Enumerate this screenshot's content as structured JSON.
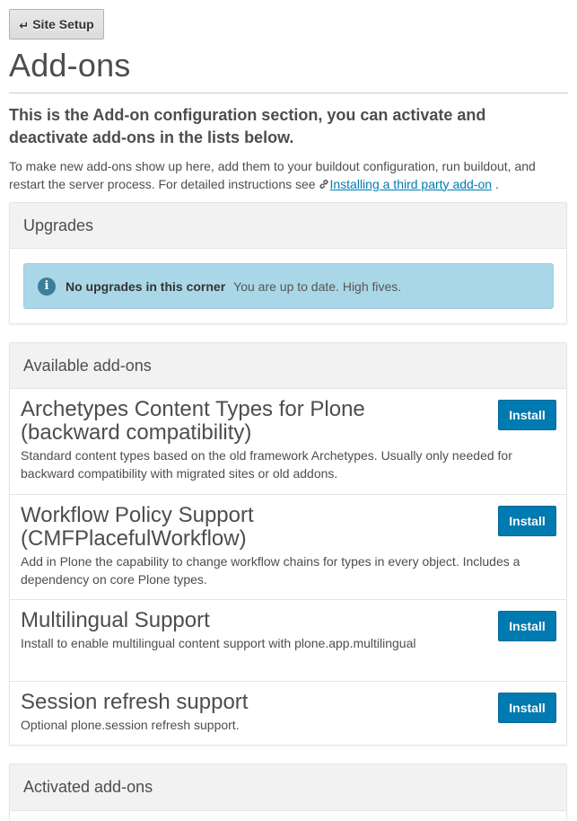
{
  "toolbar": {
    "back_label": "Site Setup"
  },
  "page": {
    "title": "Add-ons",
    "lead": "This is the Add-on configuration section, you can activate and deactivate add-ons in the lists below.",
    "instructions_text": "To make new add-ons show up here, add them to your buildout configuration, run buildout, and restart the server process. For detailed instructions see",
    "instructions_link": "Installing a third party add-on",
    "instructions_end": "."
  },
  "upgrades": {
    "heading": "Upgrades",
    "info_title": "No upgrades in this corner",
    "info_text": "You are up to date. High fives."
  },
  "available": {
    "heading": "Available add-ons",
    "install_label": "Install",
    "addons": [
      {
        "title": "Archetypes Content Types for Plone (backward compatibility)",
        "description": "Standard content types based on the old framework Archetypes. Usually only needed for backward compatibility with migrated sites or old addons."
      },
      {
        "title": "Workflow Policy Support (CMFPlacefulWorkflow)",
        "description": "Add in Plone the capability to change workflow chains for types in every object. Includes a dependency on core Plone types."
      },
      {
        "title": "Multilingual Support",
        "description": "Install to enable multilingual content support with plone.app.multilingual"
      },
      {
        "title": "Session refresh support",
        "description": "Optional plone.session refresh support."
      }
    ]
  },
  "activated": {
    "heading": "Activated add-ons"
  },
  "colors": {
    "primary": "#007bb1",
    "info_bg": "#aad7e7",
    "info_icon": "#3b7e99",
    "text": "#4d4d4d"
  },
  "icons": {
    "back": "return-arrow-icon",
    "link": "link-chain-icon",
    "info": "info-circle-icon"
  }
}
